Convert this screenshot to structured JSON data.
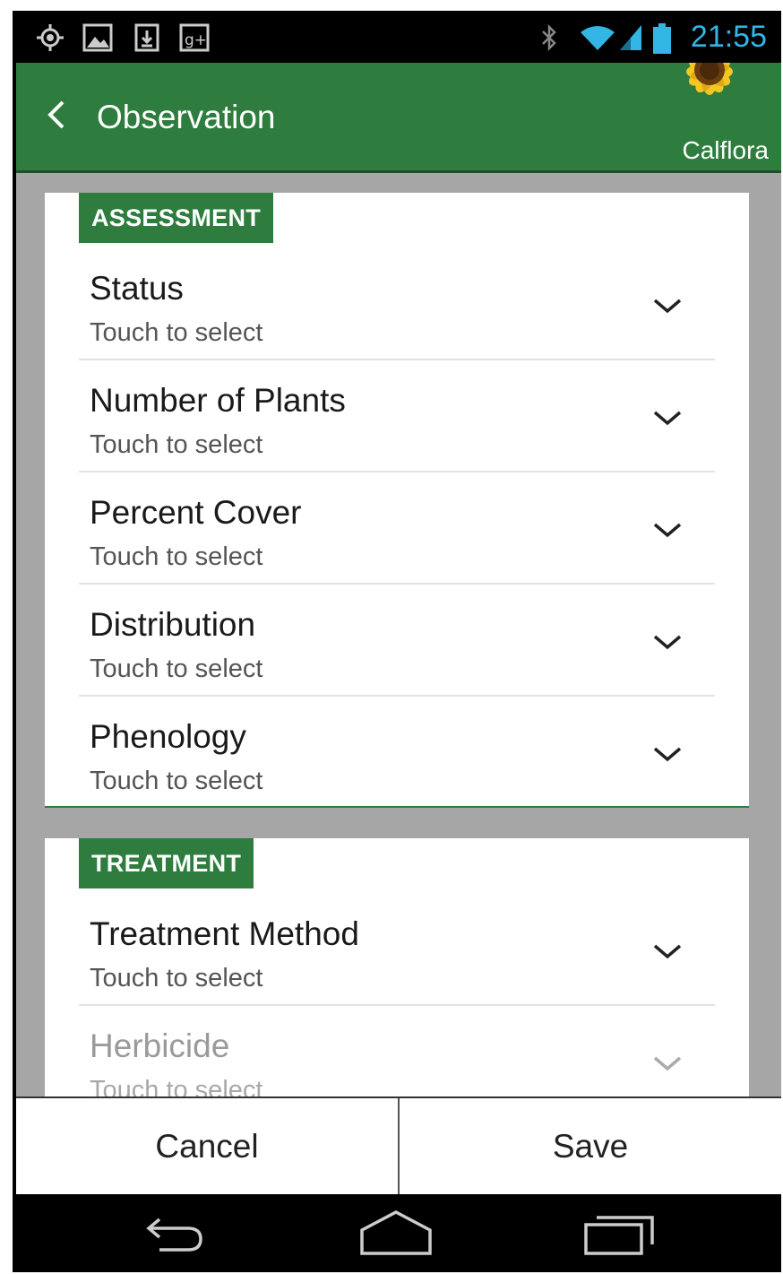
{
  "status_bar": {
    "time": "21:55",
    "icons": [
      "location-icon",
      "image-icon",
      "download-icon",
      "google-plus-icon",
      "bluetooth-icon",
      "wifi-icon",
      "signal-icon",
      "battery-icon"
    ]
  },
  "app_bar": {
    "title": "Observation",
    "logo_text": "Calflora"
  },
  "sections": [
    {
      "header": "ASSESSMENT",
      "fields": [
        {
          "label": "Status",
          "hint": "Touch to select"
        },
        {
          "label": "Number of Plants",
          "hint": "Touch to select"
        },
        {
          "label": "Percent Cover",
          "hint": "Touch to select"
        },
        {
          "label": "Distribution",
          "hint": "Touch to select"
        },
        {
          "label": "Phenology",
          "hint": "Touch to select"
        }
      ]
    },
    {
      "header": "TREATMENT",
      "fields": [
        {
          "label": "Treatment Method",
          "hint": "Touch to select"
        },
        {
          "label": "Herbicide",
          "hint": "Touch to select"
        }
      ]
    }
  ],
  "actions": {
    "cancel": "Cancel",
    "save": "Save"
  },
  "colors": {
    "primary": "#2e7d3e",
    "background": "#a6a6a6",
    "time_blue": "#33b5e5"
  }
}
